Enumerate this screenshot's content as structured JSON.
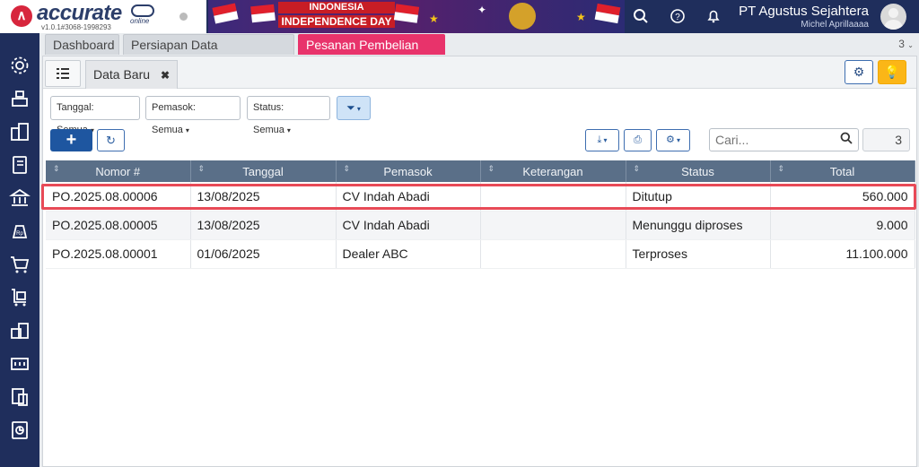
{
  "app": {
    "brand": "accurate",
    "brand_suffix": "online",
    "version": "v1.0.1#3068-1998293"
  },
  "banner": {
    "line1": "INDONESIA",
    "line2": "INDEPENDENCE DAY"
  },
  "header": {
    "company": "PT Agustus Sejahtera",
    "user": "Michel Aprillaaaa"
  },
  "tabs": [
    {
      "label": "Dashboard"
    },
    {
      "label": "Persiapan Data Perusahaan"
    },
    {
      "label": "Pesanan Pembelian",
      "close": "✖"
    }
  ],
  "tab_count": "3",
  "subtab": {
    "label": "Data Baru",
    "close": "✖"
  },
  "filters": {
    "tanggal": "Tanggal: Semua",
    "pemasok": "Pemasok: Semua",
    "status": "Status: Semua"
  },
  "search": {
    "placeholder": "Cari..."
  },
  "record_count": "3",
  "table": {
    "columns": [
      "Nomor #",
      "Tanggal",
      "Pemasok",
      "Keterangan",
      "Status",
      "Total"
    ],
    "rows": [
      {
        "nomor": "PO.2025.08.00006",
        "tanggal": "13/08/2025",
        "pemasok": "CV Indah Abadi",
        "keterangan": "",
        "status": "Ditutup",
        "total": "560.000"
      },
      {
        "nomor": "PO.2025.08.00005",
        "tanggal": "13/08/2025",
        "pemasok": "CV Indah Abadi",
        "keterangan": "",
        "status": "Menunggu diproses",
        "total": "9.000"
      },
      {
        "nomor": "PO.2025.08.00001",
        "tanggal": "01/06/2025",
        "pemasok": "Dealer ABC",
        "keterangan": "",
        "status": "Terproses",
        "total": "11.100.000"
      }
    ]
  },
  "colors": {
    "navy": "#1f2e5c",
    "accent_pink": "#e8336b",
    "primary_blue": "#1e56a0",
    "highlight_red": "#e84a57",
    "warning_yellow": "#fbb617"
  }
}
